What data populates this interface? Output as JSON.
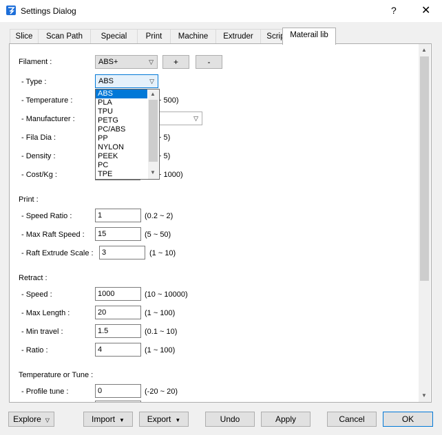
{
  "window": {
    "title": "Settings Dialog",
    "help": "?",
    "close": "✕"
  },
  "tabs": [
    "Slice",
    "Scan Path",
    "Special",
    "Print",
    "Machine",
    "Extruder",
    "Script",
    "Materail lib"
  ],
  "filament": {
    "label": "Filament :",
    "value": "ABS+",
    "add": "+",
    "remove": "-"
  },
  "type": {
    "label": "- Type :",
    "value": "ABS",
    "options": [
      "ABS",
      "PLA",
      "TPU",
      "PETG",
      "PC/ABS",
      "PP",
      "NYLON",
      "PEEK",
      "PC",
      "TPE"
    ]
  },
  "temperature": {
    "label": "- Temperature :",
    "range": "~ 500)"
  },
  "manufacturer": {
    "label": "- Manufacturer :"
  },
  "fila_dia": {
    "label": "- Fila Dia :",
    "range": "~ 5)"
  },
  "density": {
    "label": "- Density :",
    "range": "~ 5)"
  },
  "cost": {
    "label": "- Cost/Kg :",
    "range": "~ 1000)"
  },
  "print": {
    "heading": "Print :",
    "speed_ratio": {
      "label": "- Speed Ratio :",
      "value": "1",
      "range": "(0.2 ~ 2)"
    },
    "max_raft_speed": {
      "label": "- Max Raft Speed :",
      "value": "15",
      "range": "(5 ~ 50)"
    },
    "raft_extrude_scale": {
      "label": "- Raft Extrude Scale :",
      "value": "3",
      "range": "(1 ~ 10)"
    }
  },
  "retract": {
    "heading": "Retract :",
    "speed": {
      "label": "- Speed :",
      "value": "1000",
      "range": "(10 ~ 10000)"
    },
    "max_length": {
      "label": "- Max Length :",
      "value": "20",
      "range": "(1 ~ 100)"
    },
    "min_travel": {
      "label": "- Min travel :",
      "value": "1.5",
      "range": "(0.1 ~ 10)"
    },
    "ratio": {
      "label": "- Ratio :",
      "value": "4",
      "range": "(1 ~ 100)"
    }
  },
  "tune": {
    "heading": "Temperature or Tune :",
    "profile_tune": {
      "label": "- Profile tune :",
      "value": "0",
      "range": "(-20 ~ 20)"
    }
  },
  "bottom": {
    "explore": "Explore",
    "import": "Import",
    "export": "Export",
    "undo": "Undo",
    "apply": "Apply",
    "cancel": "Cancel",
    "ok": "OK"
  }
}
